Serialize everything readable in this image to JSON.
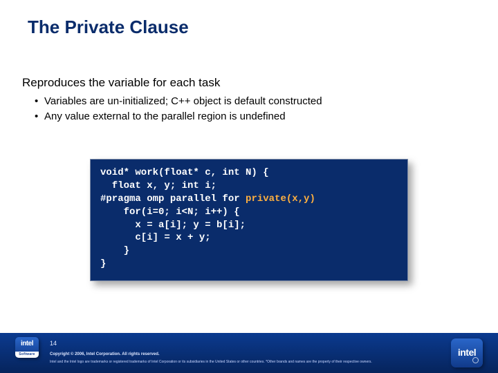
{
  "title": "The Private Clause",
  "lead": "Reproduces the variable for each task",
  "bullets": [
    "Variables are un-initialized; C++ object is default constructed",
    "Any value external to the parallel region is undefined"
  ],
  "code": {
    "l1a": "void* work(float* c, int N) {",
    "l2": "  float x, y; int i;",
    "l3a": "#pragma omp parallel for ",
    "l3b": "private(x,y)",
    "l4": "    for(i=0; i<N; i++) {",
    "l5": "      x = a[i]; y = b[i];",
    "l6": "      c[i] = x + y;",
    "l7": "    }",
    "l8": "}"
  },
  "badge": {
    "brand": "intel",
    "sublabel": "Software"
  },
  "footer": {
    "page": "14",
    "copyright": "Copyright © 2006, Intel Corporation. All rights reserved.",
    "legal": "Intel and the Intel logo are trademarks or registered trademarks of Intel Corporation or its subsidiaries in the United States or other countries. *Other brands and names are the property of their respective owners."
  }
}
